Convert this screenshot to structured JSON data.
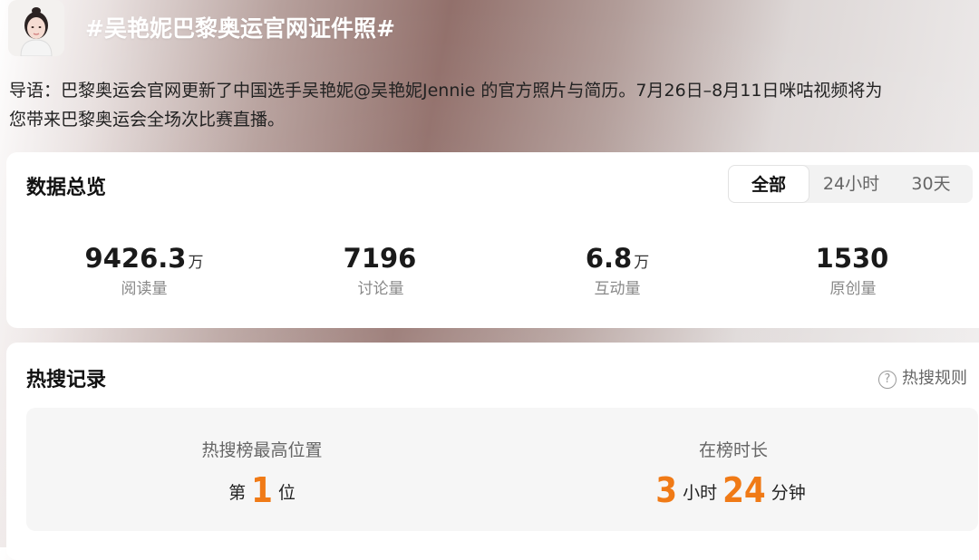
{
  "topic": {
    "title": "#吴艳妮巴黎奥运官网证件照#"
  },
  "intro": {
    "line1": "导语：巴黎奥运会官网更新了中国选手吴艳妮@吴艳妮Jennie 的官方照片与简历。7月26日–8月11日咪咕视频将为",
    "line2": "您带来巴黎奥运会全场次比赛直播。"
  },
  "overview": {
    "title": "数据总览",
    "tabs": {
      "all": "全部",
      "h24": "24小时",
      "d30": "30天",
      "selected": "全部"
    },
    "stats": {
      "read": {
        "value": "9426.3",
        "unit": "万",
        "label": "阅读量"
      },
      "discuss": {
        "value": "7196",
        "unit": "",
        "label": "讨论量"
      },
      "interact": {
        "value": "6.8",
        "unit": "万",
        "label": "互动量"
      },
      "original": {
        "value": "1530",
        "unit": "",
        "label": "原创量"
      }
    }
  },
  "hot": {
    "title": "热搜记录",
    "rules_label": "热搜规则",
    "peak": {
      "label": "热搜榜最高位置",
      "prefix": "第",
      "value": "1",
      "suffix": "位"
    },
    "duration": {
      "label": "在榜时长",
      "hours": "3",
      "hours_unit": "小时",
      "minutes": "24",
      "minutes_unit": "分钟"
    }
  },
  "colors": {
    "accent": "#f07a16",
    "card": "#ffffff",
    "panel": "#f6f6f6"
  },
  "icons": {
    "rules": "question-circle-icon"
  }
}
